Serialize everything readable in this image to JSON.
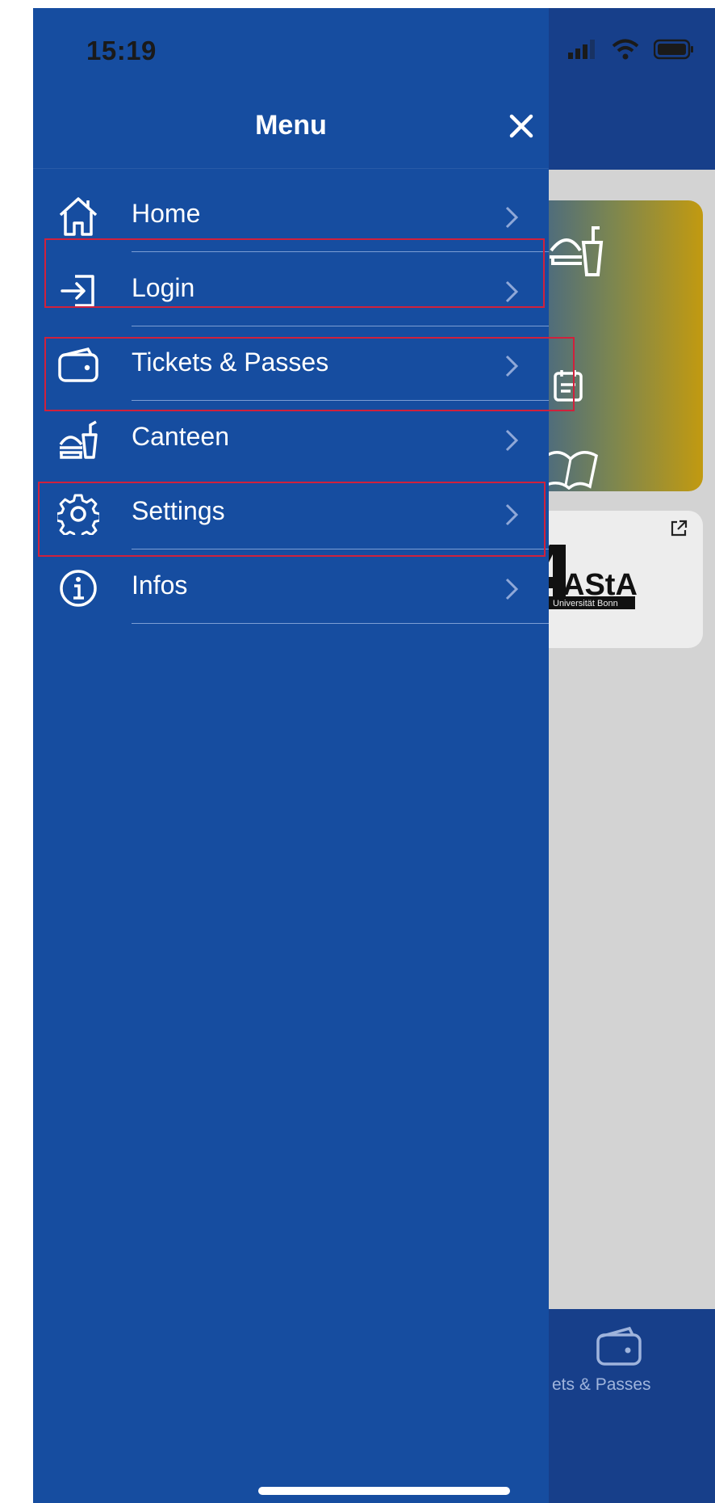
{
  "status_bar": {
    "time": "15:19"
  },
  "drawer": {
    "title": "Menu",
    "items": [
      {
        "label": "Home",
        "icon": "home-icon"
      },
      {
        "label": "Login",
        "icon": "login-icon"
      },
      {
        "label": "Tickets & Passes",
        "icon": "wallet-icon"
      },
      {
        "label": "Canteen",
        "icon": "canteen-icon"
      },
      {
        "label": "Settings",
        "icon": "gear-icon"
      },
      {
        "label": "Infos",
        "icon": "info-icon"
      }
    ]
  },
  "background": {
    "tab_label": "ets & Passes",
    "asta_logo_text": "AStA",
    "asta_logo_sub": "Universität Bonn"
  },
  "colors": {
    "drawer": "#164da0",
    "header": "#173f8a",
    "highlight": "#d0213c",
    "card_gold": "#c29a10"
  }
}
